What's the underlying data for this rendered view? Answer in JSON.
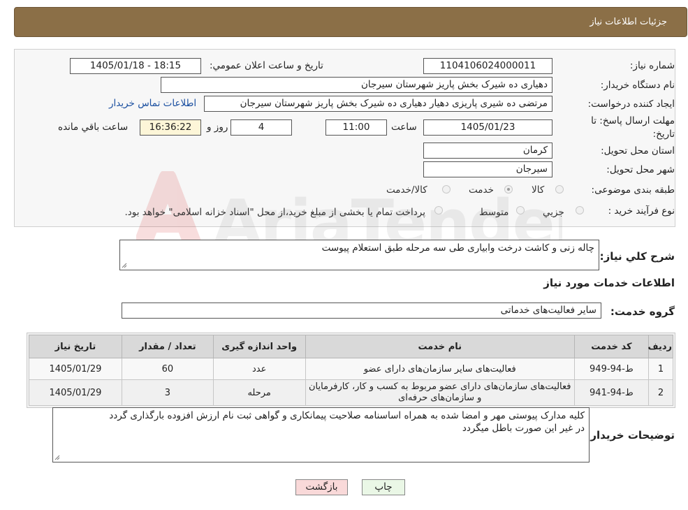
{
  "header": {
    "title": "جزئیات اطلاعات نیاز"
  },
  "need_number": {
    "label": "شماره نیاز:",
    "value": "1104106024000011"
  },
  "announce_datetime": {
    "label": "تاریخ و ساعت اعلان عمومي:",
    "value": "1405/01/18 - 18:15"
  },
  "buyer_org": {
    "label": "نام دستگاه خریدار:",
    "value": "دهیاری ده شیرک بخش پاریز شهرستان سیرجان"
  },
  "requester": {
    "label": "ایجاد کننده درخواست:",
    "value": "مرتضی ده شیری پاریزی دهیار دهیاری ده شیرک بخش پاریز شهرستان سیرجان",
    "contact_link": "اطلاعات تماس خریدار"
  },
  "deadline": {
    "label_line1": "مهلت ارسال پاسخ: تا",
    "label_line2": "تاریخ:",
    "date": "1405/01/23",
    "time_label": "ساعت",
    "time": "11:00",
    "days": "4",
    "days_label": "روز و",
    "remaining": "16:36:22",
    "remaining_label": "ساعت باقي مانده"
  },
  "province": {
    "label": "استان محل تحویل:",
    "value": "کرمان"
  },
  "city": {
    "label": "شهر محل تحویل:",
    "value": "سیرجان"
  },
  "category": {
    "label": "طبقه بندی موضوعی:",
    "options": [
      "کالا",
      "خدمت",
      "کالا/خدمت"
    ],
    "selected": "خدمت"
  },
  "purchase_type": {
    "label": "نوع فرآیند خرید :",
    "options": [
      "جزیي",
      "متوسط"
    ],
    "selected": "",
    "note": "پرداخت تمام یا بخشی از مبلغ خرید،از محل \"اسناد خزانه اسلامی\" خواهد بود."
  },
  "description": {
    "label": "شرح کلي نیاز:",
    "value": "چاله زنی و کاشت درخت وابیاری طی سه مرحله طبق استعلام پیوست"
  },
  "services_title": "اطلاعات خدمات مورد نیاز",
  "service_group": {
    "label": "گروه خدمت:",
    "value": "سایر فعالیت‌های خدماتی"
  },
  "table": {
    "headers": [
      "ردیف",
      "کد خدمت",
      "نام خدمت",
      "واحد اندازه گیری",
      "تعداد / مقدار",
      "تاریخ نیاز"
    ],
    "rows": [
      {
        "idx": "1",
        "code": "ط-94-949",
        "name": "فعالیت‌های سایر سازمان‌های دارای عضو",
        "unit": "عدد",
        "qty": "60",
        "date": "1405/01/29"
      },
      {
        "idx": "2",
        "code": "ط-94-941",
        "name": "فعالیت‌های سازمان‌های دارای عضو مربوط به کسب و کار، کارفرمایان و سازمان‌های حرفه‌ای",
        "unit": "مرحله",
        "qty": "3",
        "date": "1405/01/29"
      }
    ]
  },
  "buyer_notes": {
    "label": "توضیحات خریدار:",
    "line1": "کلیه مدارک پیوستی مهر و امضا شده به همراه اساسنامه صلاحیت پیمانکاری و گواهی ثبت نام ارزش افزوده بارگذاری گردد",
    "line2": "در غیر این صورت باطل میگردد"
  },
  "buttons": {
    "print": "چاپ",
    "back": "بازگشت"
  },
  "colors": {
    "header_bg": "#8b6f47",
    "print_bg": "#eaf7e6",
    "back_bg": "#f9d9d9"
  }
}
